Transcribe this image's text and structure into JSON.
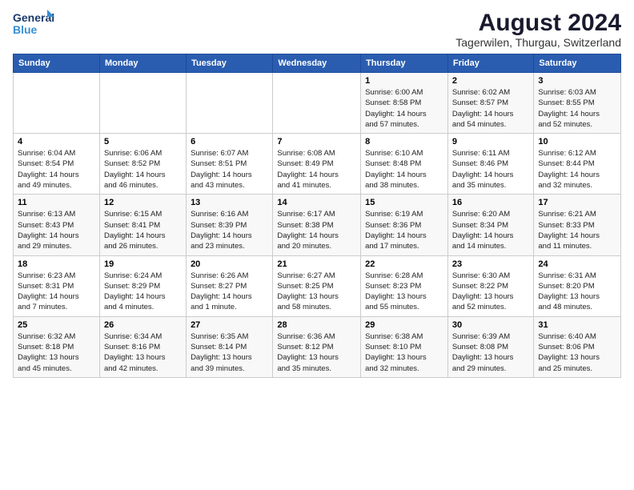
{
  "logo": {
    "line1": "General",
    "line2": "Blue"
  },
  "title": "August 2024",
  "subtitle": "Tagerwilen, Thurgau, Switzerland",
  "days_of_week": [
    "Sunday",
    "Monday",
    "Tuesday",
    "Wednesday",
    "Thursday",
    "Friday",
    "Saturday"
  ],
  "weeks": [
    [
      {
        "num": "",
        "info": ""
      },
      {
        "num": "",
        "info": ""
      },
      {
        "num": "",
        "info": ""
      },
      {
        "num": "",
        "info": ""
      },
      {
        "num": "1",
        "info": "Sunrise: 6:00 AM\nSunset: 8:58 PM\nDaylight: 14 hours\nand 57 minutes."
      },
      {
        "num": "2",
        "info": "Sunrise: 6:02 AM\nSunset: 8:57 PM\nDaylight: 14 hours\nand 54 minutes."
      },
      {
        "num": "3",
        "info": "Sunrise: 6:03 AM\nSunset: 8:55 PM\nDaylight: 14 hours\nand 52 minutes."
      }
    ],
    [
      {
        "num": "4",
        "info": "Sunrise: 6:04 AM\nSunset: 8:54 PM\nDaylight: 14 hours\nand 49 minutes."
      },
      {
        "num": "5",
        "info": "Sunrise: 6:06 AM\nSunset: 8:52 PM\nDaylight: 14 hours\nand 46 minutes."
      },
      {
        "num": "6",
        "info": "Sunrise: 6:07 AM\nSunset: 8:51 PM\nDaylight: 14 hours\nand 43 minutes."
      },
      {
        "num": "7",
        "info": "Sunrise: 6:08 AM\nSunset: 8:49 PM\nDaylight: 14 hours\nand 41 minutes."
      },
      {
        "num": "8",
        "info": "Sunrise: 6:10 AM\nSunset: 8:48 PM\nDaylight: 14 hours\nand 38 minutes."
      },
      {
        "num": "9",
        "info": "Sunrise: 6:11 AM\nSunset: 8:46 PM\nDaylight: 14 hours\nand 35 minutes."
      },
      {
        "num": "10",
        "info": "Sunrise: 6:12 AM\nSunset: 8:44 PM\nDaylight: 14 hours\nand 32 minutes."
      }
    ],
    [
      {
        "num": "11",
        "info": "Sunrise: 6:13 AM\nSunset: 8:43 PM\nDaylight: 14 hours\nand 29 minutes."
      },
      {
        "num": "12",
        "info": "Sunrise: 6:15 AM\nSunset: 8:41 PM\nDaylight: 14 hours\nand 26 minutes."
      },
      {
        "num": "13",
        "info": "Sunrise: 6:16 AM\nSunset: 8:39 PM\nDaylight: 14 hours\nand 23 minutes."
      },
      {
        "num": "14",
        "info": "Sunrise: 6:17 AM\nSunset: 8:38 PM\nDaylight: 14 hours\nand 20 minutes."
      },
      {
        "num": "15",
        "info": "Sunrise: 6:19 AM\nSunset: 8:36 PM\nDaylight: 14 hours\nand 17 minutes."
      },
      {
        "num": "16",
        "info": "Sunrise: 6:20 AM\nSunset: 8:34 PM\nDaylight: 14 hours\nand 14 minutes."
      },
      {
        "num": "17",
        "info": "Sunrise: 6:21 AM\nSunset: 8:33 PM\nDaylight: 14 hours\nand 11 minutes."
      }
    ],
    [
      {
        "num": "18",
        "info": "Sunrise: 6:23 AM\nSunset: 8:31 PM\nDaylight: 14 hours\nand 7 minutes."
      },
      {
        "num": "19",
        "info": "Sunrise: 6:24 AM\nSunset: 8:29 PM\nDaylight: 14 hours\nand 4 minutes."
      },
      {
        "num": "20",
        "info": "Sunrise: 6:26 AM\nSunset: 8:27 PM\nDaylight: 14 hours\nand 1 minute."
      },
      {
        "num": "21",
        "info": "Sunrise: 6:27 AM\nSunset: 8:25 PM\nDaylight: 13 hours\nand 58 minutes."
      },
      {
        "num": "22",
        "info": "Sunrise: 6:28 AM\nSunset: 8:23 PM\nDaylight: 13 hours\nand 55 minutes."
      },
      {
        "num": "23",
        "info": "Sunrise: 6:30 AM\nSunset: 8:22 PM\nDaylight: 13 hours\nand 52 minutes."
      },
      {
        "num": "24",
        "info": "Sunrise: 6:31 AM\nSunset: 8:20 PM\nDaylight: 13 hours\nand 48 minutes."
      }
    ],
    [
      {
        "num": "25",
        "info": "Sunrise: 6:32 AM\nSunset: 8:18 PM\nDaylight: 13 hours\nand 45 minutes."
      },
      {
        "num": "26",
        "info": "Sunrise: 6:34 AM\nSunset: 8:16 PM\nDaylight: 13 hours\nand 42 minutes."
      },
      {
        "num": "27",
        "info": "Sunrise: 6:35 AM\nSunset: 8:14 PM\nDaylight: 13 hours\nand 39 minutes."
      },
      {
        "num": "28",
        "info": "Sunrise: 6:36 AM\nSunset: 8:12 PM\nDaylight: 13 hours\nand 35 minutes."
      },
      {
        "num": "29",
        "info": "Sunrise: 6:38 AM\nSunset: 8:10 PM\nDaylight: 13 hours\nand 32 minutes."
      },
      {
        "num": "30",
        "info": "Sunrise: 6:39 AM\nSunset: 8:08 PM\nDaylight: 13 hours\nand 29 minutes."
      },
      {
        "num": "31",
        "info": "Sunrise: 6:40 AM\nSunset: 8:06 PM\nDaylight: 13 hours\nand 25 minutes."
      }
    ]
  ]
}
